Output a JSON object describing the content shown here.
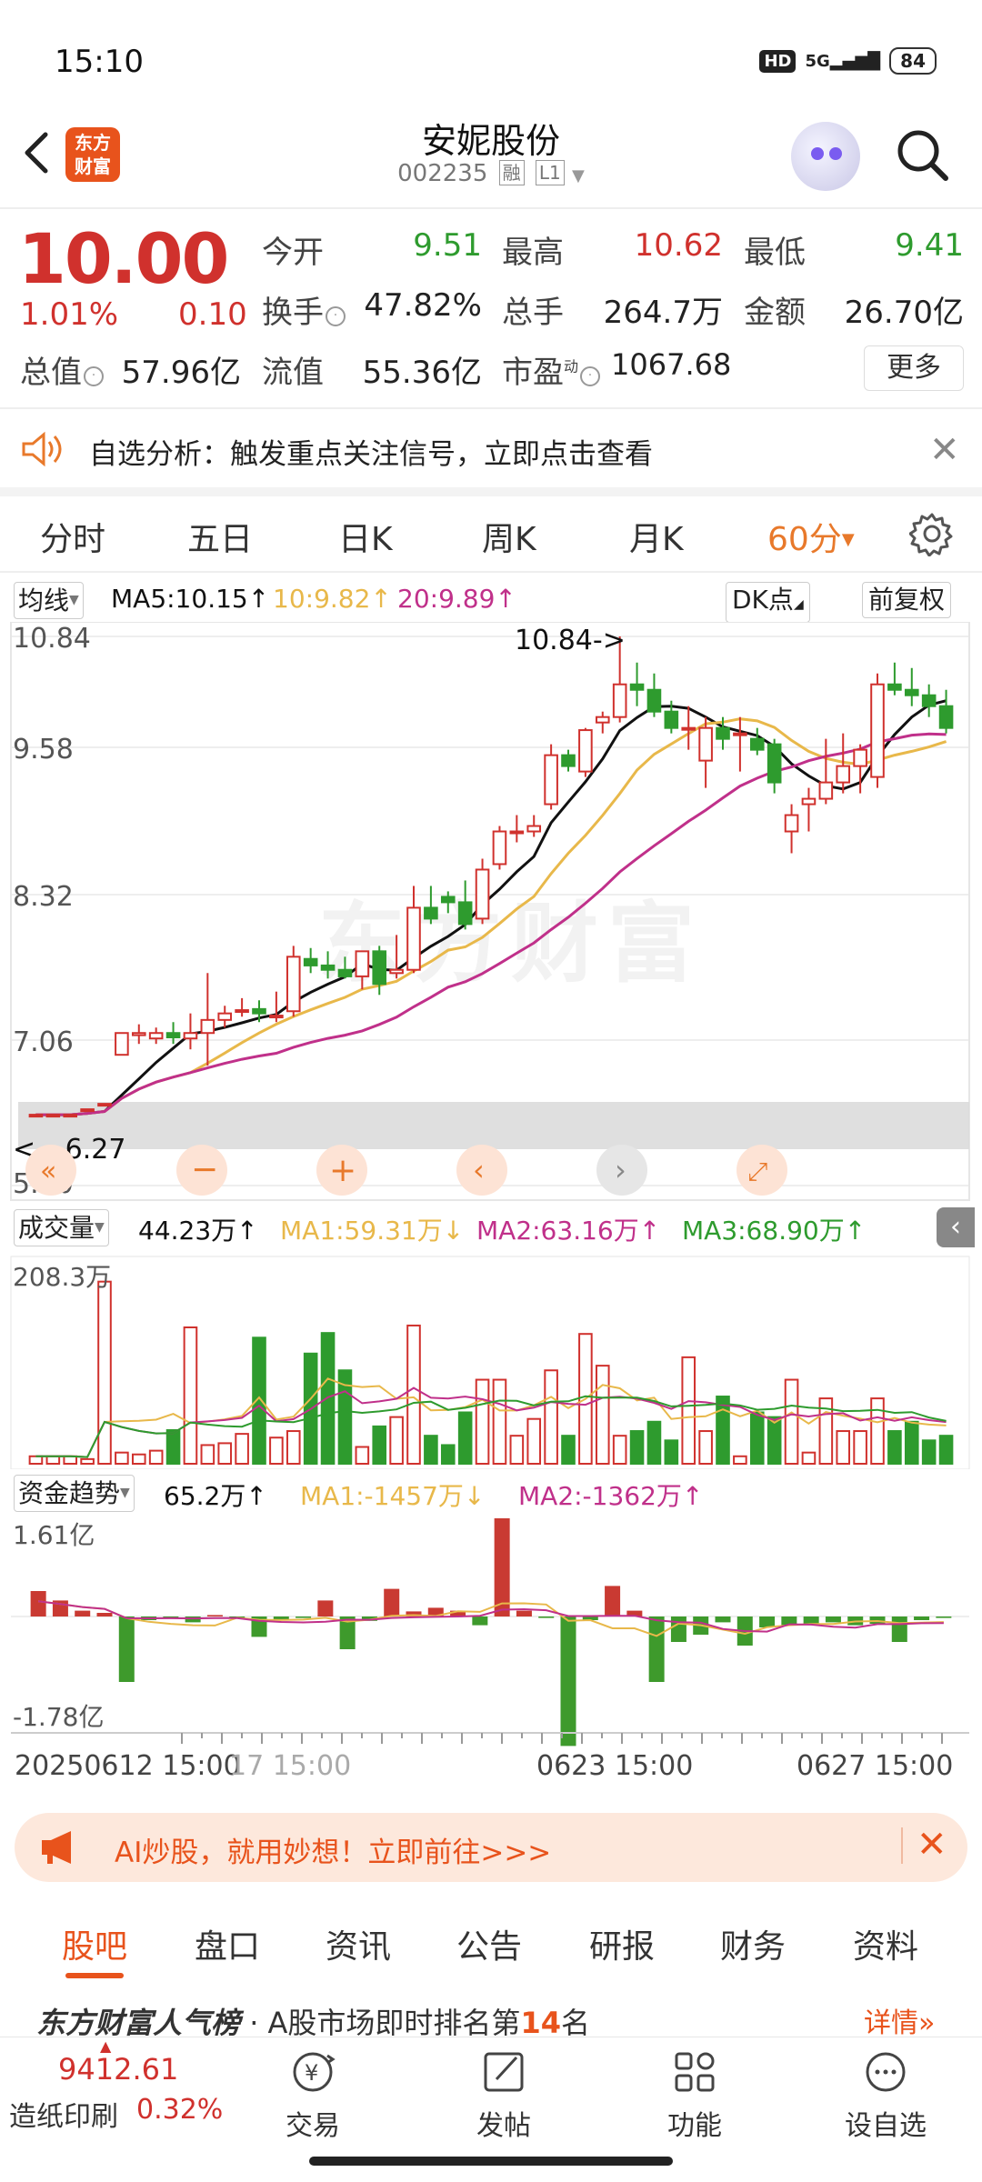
{
  "status_bar": {
    "time": "15:10",
    "hd": "HD",
    "network": "5G",
    "battery": "84"
  },
  "header": {
    "logo_line1": "东方",
    "logo_line2": "财富",
    "stock_name": "安妮股份",
    "stock_code": "002235",
    "tag_margin": "融",
    "tag_level": "L1"
  },
  "quote": {
    "price": "10.00",
    "change_pct": "1.01%",
    "change": "0.10",
    "open_label": "今开",
    "open": "9.51",
    "high_label": "最高",
    "high": "10.62",
    "low_label": "最低",
    "low": "9.41",
    "turnover_label": "换手",
    "turnover": "47.82%",
    "volume_label": "总手",
    "volume": "264.7万",
    "amount_label": "金额",
    "amount": "26.70亿",
    "mktcap_label": "总值",
    "mktcap": "57.96亿",
    "float_label": "流值",
    "float": "55.36亿",
    "pe_label": "市盈",
    "pe_sup": "动",
    "pe": "1067.68",
    "more_label": "更多"
  },
  "alert": {
    "text": "自选分析：触发重点关注信号，立即点击查看"
  },
  "period_tabs": [
    "分时",
    "五日",
    "日K",
    "周K",
    "月K",
    "60分"
  ],
  "ma_legend": {
    "selector": "均线",
    "ma5": "MA5:10.15",
    "ma10": "10:9.82",
    "ma20": "20:9.89",
    "dk_label": "DK点",
    "fuquan_label": "前复权"
  },
  "price_chart": {
    "y_labels": [
      "10.84",
      "9.58",
      "8.32",
      "7.06",
      "5.80"
    ],
    "high_marker": "10.84->",
    "low_marker": "<---6.27"
  },
  "volume_legend": {
    "selector": "成交量",
    "current": "44.23万",
    "ma1": "MA1:59.31万",
    "ma2": "MA2:63.16万",
    "ma3": "MA3:68.90万",
    "y_top": "208.3万"
  },
  "fund_legend": {
    "selector": "资金趋势",
    "current": "65.2万",
    "ma1": "MA1:-1457万",
    "ma2": "MA2:-1362万",
    "y_top": "1.61亿",
    "y_bottom": "-1.78亿"
  },
  "x_axis": {
    "start": "20250612 15:00",
    "partial": "17 15:00",
    "mid": "0623 15:00",
    "end": "0627 15:00"
  },
  "ai_banner": {
    "text": "AI炒股，就用妙想！立即前往>>>"
  },
  "content_tabs": [
    "股吧",
    "盘口",
    "资讯",
    "公告",
    "研报",
    "财务",
    "资料"
  ],
  "rank": {
    "title": "东方财富人气榜",
    "text_prefix": "· A股市场即时排名第",
    "rank_no": "14",
    "text_suffix": "名",
    "detail": "详情"
  },
  "bottom_nav": {
    "index_value": "9412.61",
    "index_name": "造纸印刷",
    "index_pct": "0.32%",
    "items": [
      "交易",
      "发帖",
      "功能",
      "设自选"
    ]
  },
  "colors": {
    "up": "#d0312d",
    "down": "#2e9b2e",
    "accent": "#e8792b",
    "ma5": "#111111",
    "ma10": "#e8b84a",
    "ma20": "#c0308a"
  },
  "chart_data": {
    "type": "candlestick",
    "interval": "60min",
    "y_range": [
      5.8,
      10.84
    ],
    "candles": [
      [
        6.45,
        6.45,
        6.45,
        6.45
      ],
      [
        6.45,
        6.45,
        6.45,
        6.45
      ],
      [
        6.45,
        6.45,
        6.45,
        6.45
      ],
      [
        6.5,
        6.5,
        6.5,
        6.5
      ],
      [
        6.55,
        6.55,
        6.55,
        6.55
      ],
      [
        7.0,
        7.2,
        7.0,
        7.2
      ],
      [
        7.18,
        7.28,
        7.1,
        7.2
      ],
      [
        7.15,
        7.25,
        7.1,
        7.2
      ],
      [
        7.2,
        7.3,
        7.1,
        7.16
      ],
      [
        7.15,
        7.38,
        7.05,
        7.2
      ],
      [
        7.2,
        7.75,
        6.9,
        7.32
      ],
      [
        7.32,
        7.45,
        7.25,
        7.38
      ],
      [
        7.4,
        7.52,
        7.35,
        7.41
      ],
      [
        7.42,
        7.5,
        7.3,
        7.38
      ],
      [
        7.35,
        7.58,
        7.3,
        7.36
      ],
      [
        7.4,
        8.0,
        7.35,
        7.9
      ],
      [
        7.88,
        7.98,
        7.75,
        7.82
      ],
      [
        7.82,
        7.95,
        7.7,
        7.78
      ],
      [
        7.78,
        7.9,
        7.7,
        7.72
      ],
      [
        7.72,
        7.95,
        7.6,
        7.95
      ],
      [
        7.95,
        8.0,
        7.55,
        7.65
      ],
      [
        7.75,
        8.1,
        7.7,
        7.78
      ],
      [
        7.78,
        8.55,
        7.75,
        8.35
      ],
      [
        8.35,
        8.55,
        8.2,
        8.25
      ],
      [
        8.45,
        8.5,
        8.3,
        8.4
      ],
      [
        8.4,
        8.6,
        8.15,
        8.2
      ],
      [
        8.25,
        8.8,
        8.2,
        8.7
      ],
      [
        8.75,
        9.1,
        8.7,
        9.05
      ],
      [
        9.05,
        9.2,
        8.95,
        9.05
      ],
      [
        9.05,
        9.2,
        9.0,
        9.1
      ],
      [
        9.3,
        9.85,
        9.25,
        9.75
      ],
      [
        9.75,
        9.8,
        9.6,
        9.65
      ],
      [
        9.6,
        10.0,
        9.55,
        9.98
      ],
      [
        10.05,
        10.15,
        9.95,
        10.1
      ],
      [
        10.1,
        10.84,
        10.05,
        10.4
      ],
      [
        10.4,
        10.6,
        10.2,
        10.35
      ],
      [
        10.35,
        10.5,
        10.1,
        10.15
      ],
      [
        10.15,
        10.25,
        9.95,
        10.0
      ],
      [
        10.0,
        10.2,
        9.8,
        10.0
      ],
      [
        9.7,
        10.1,
        9.45,
        10.0
      ],
      [
        10.0,
        10.1,
        9.8,
        9.9
      ],
      [
        9.95,
        10.1,
        9.6,
        9.95
      ],
      [
        9.9,
        10.0,
        9.75,
        9.8
      ],
      [
        9.85,
        9.9,
        9.4,
        9.5
      ],
      [
        9.05,
        9.3,
        8.85,
        9.2
      ],
      [
        9.3,
        9.45,
        9.05,
        9.35
      ],
      [
        9.35,
        9.9,
        9.3,
        9.5
      ],
      [
        9.5,
        9.95,
        9.4,
        9.65
      ],
      [
        9.65,
        9.85,
        9.4,
        9.8
      ],
      [
        9.55,
        10.5,
        9.45,
        10.4
      ],
      [
        10.4,
        10.6,
        10.3,
        10.35
      ],
      [
        10.35,
        10.55,
        10.2,
        10.3
      ],
      [
        10.3,
        10.4,
        10.1,
        10.2
      ],
      [
        10.2,
        10.35,
        9.95,
        10.0
      ]
    ],
    "volume": [
      0.08,
      0.08,
      0.08,
      0.05,
      1.95,
      0.12,
      0.1,
      0.14,
      0.36,
      1.46,
      0.2,
      0.22,
      0.32,
      1.35,
      0.28,
      0.35,
      1.18,
      1.4,
      1.0,
      0.18,
      0.4,
      0.5,
      1.48,
      0.3,
      0.2,
      0.55,
      0.9,
      0.9,
      0.3,
      0.48,
      1.0,
      0.3,
      1.39,
      1.05,
      0.3,
      0.35,
      0.45,
      0.25,
      1.14,
      0.35,
      0.72,
      0.08,
      0.55,
      0.5,
      0.9,
      0.12,
      0.7,
      0.35,
      0.35,
      0.7,
      0.35,
      0.45,
      0.25,
      0.3
    ],
    "fund_flow": [
      0.35,
      0.22,
      0.08,
      0.05,
      -0.9,
      -0.05,
      -0.02,
      -0.08,
      0.02,
      -0.02,
      -0.28,
      -0.05,
      -0.02,
      0.22,
      -0.45,
      -0.06,
      0.38,
      0.07,
      0.12,
      0.08,
      -0.12,
      1.35,
      0.08,
      -0.02,
      -1.78,
      -0.05,
      0.42,
      0.08,
      -0.9,
      -0.35,
      -0.25,
      -0.08,
      -0.4,
      -0.15,
      -0.12,
      -0.1,
      -0.08,
      -0.12,
      -0.1,
      -0.35,
      -0.05,
      -0.02
    ],
    "x_labels": [
      "20250612 15:00",
      "17 15:00",
      "0623 15:00",
      "0627 15:00"
    ]
  }
}
